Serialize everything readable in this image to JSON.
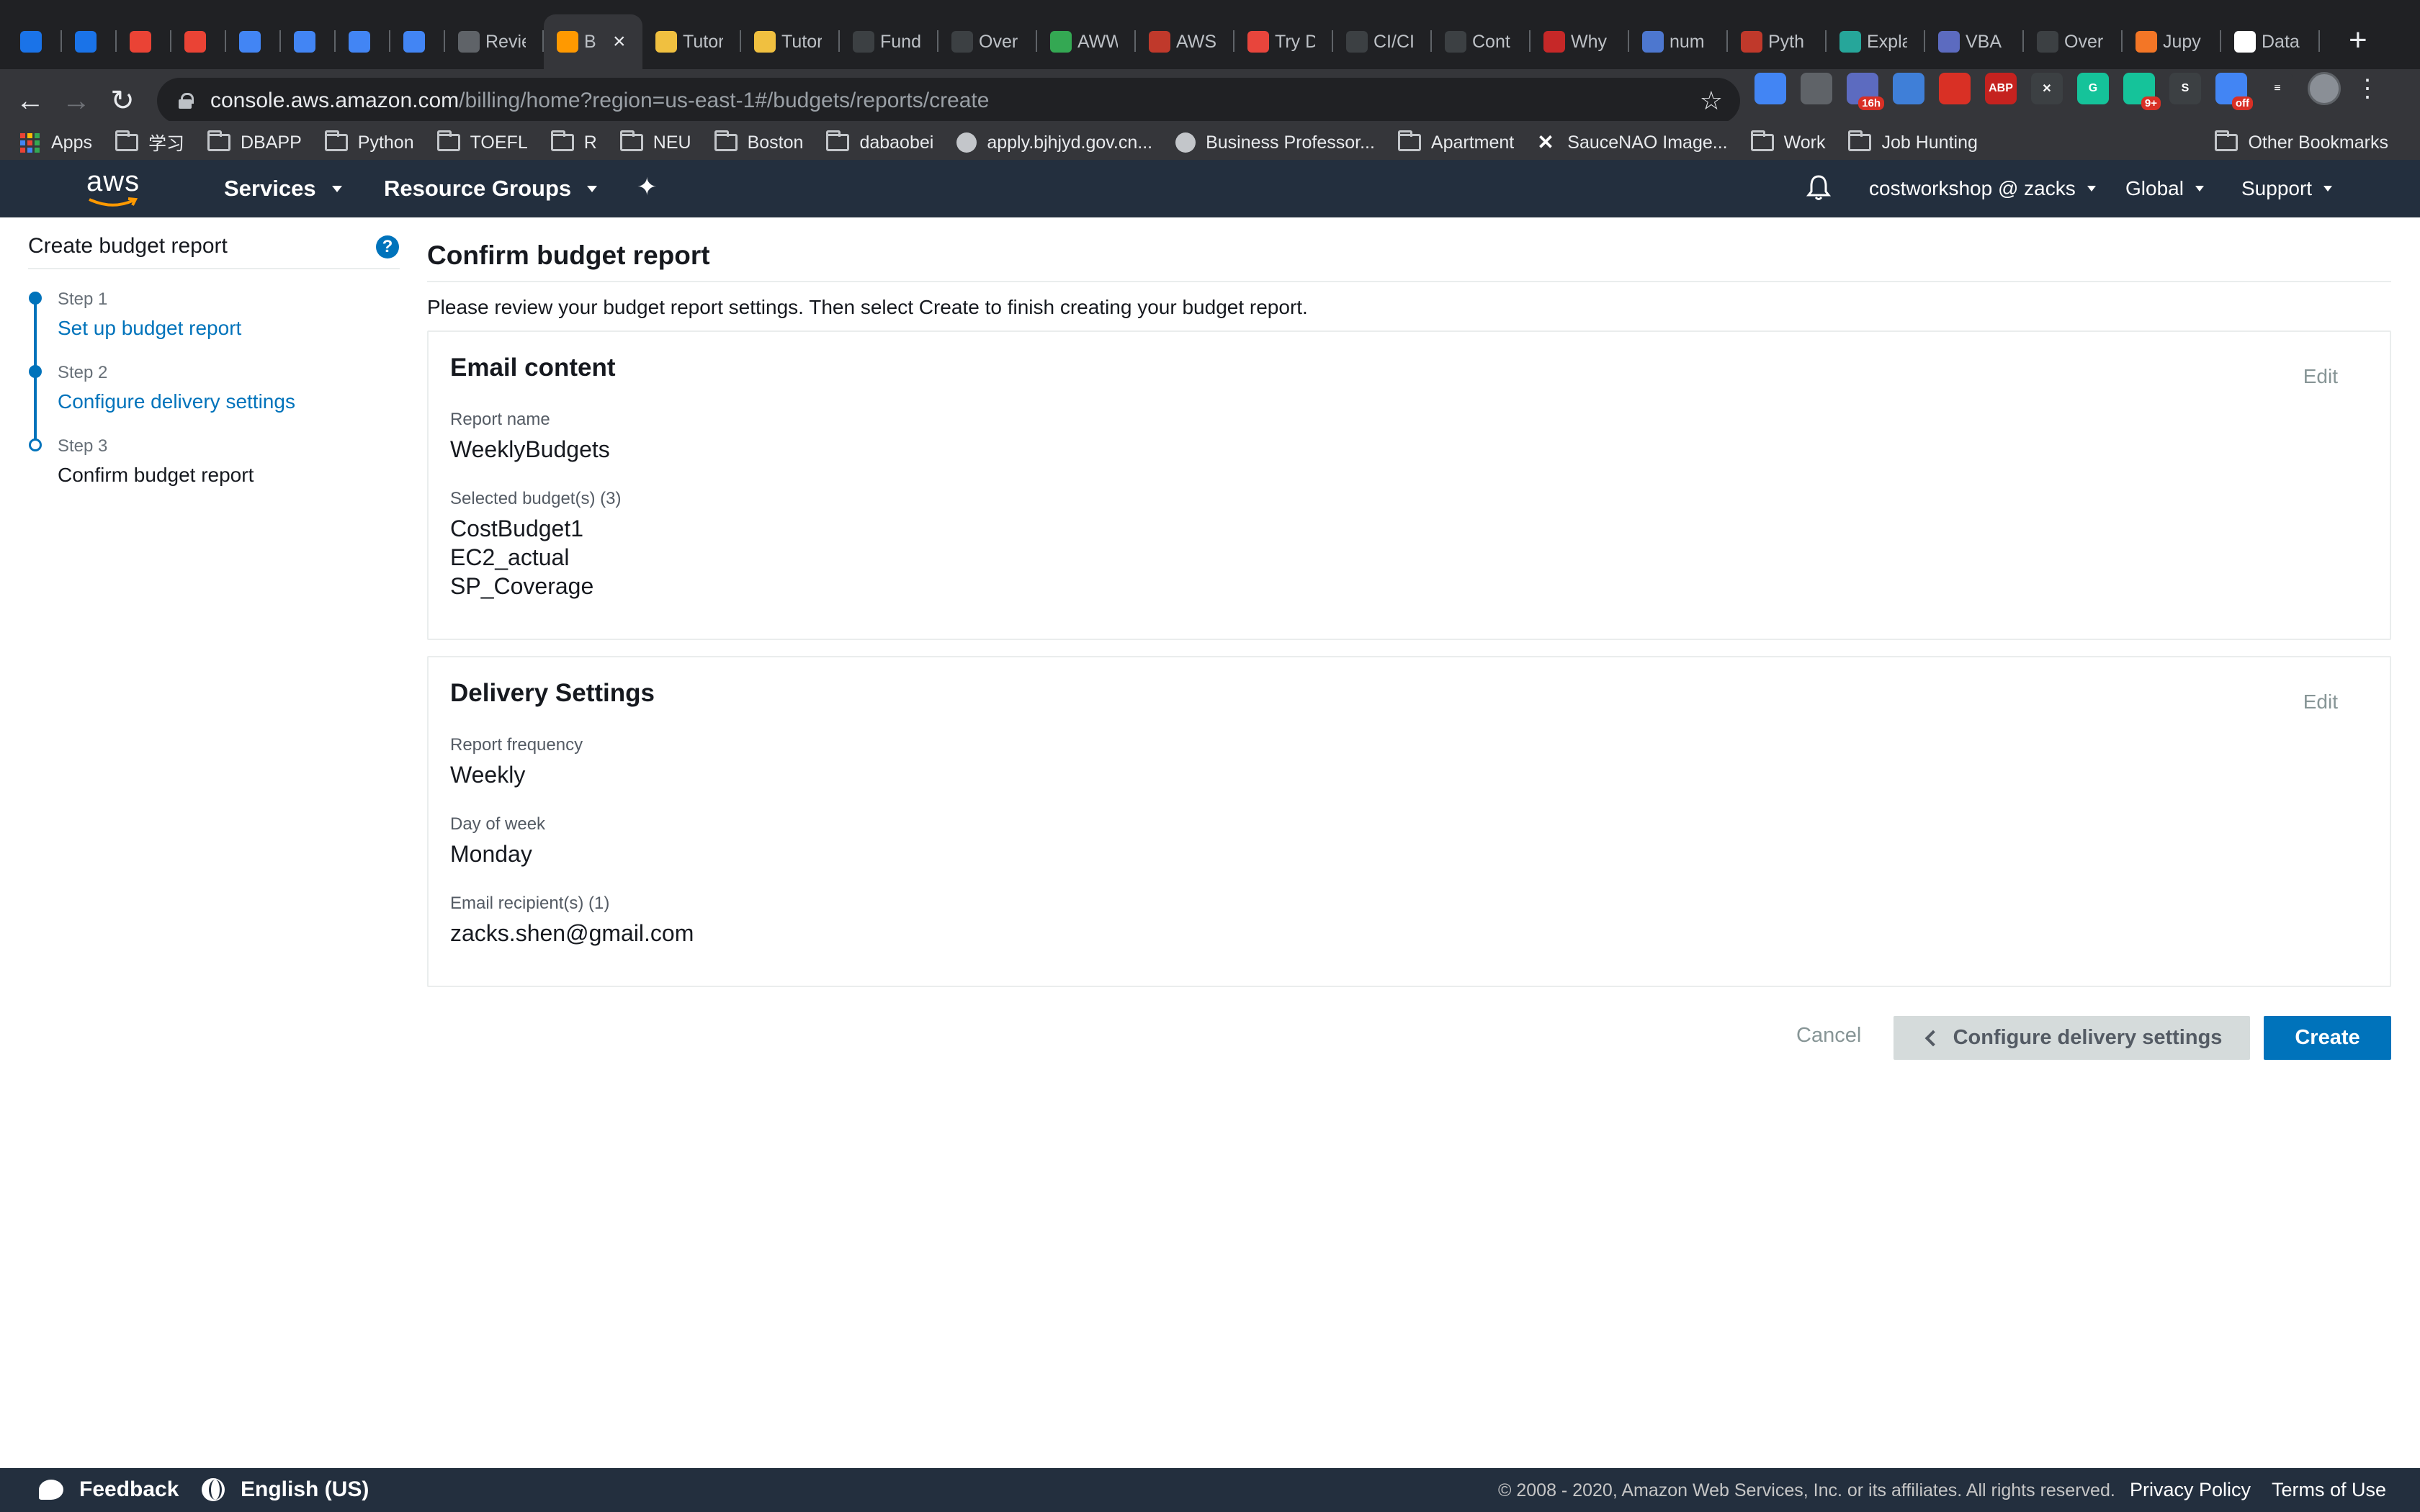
{
  "browser": {
    "tabs": [
      {
        "title": "",
        "icon": "google-calendar-icon",
        "color": "#1a73e8"
      },
      {
        "title": "",
        "icon": "google-calendar-icon",
        "color": "#1a73e8"
      },
      {
        "title": "",
        "icon": "gmail-icon",
        "color": "#ea4335"
      },
      {
        "title": "",
        "icon": "gmail-icon",
        "color": "#ea4335"
      },
      {
        "title": "",
        "icon": "google-translate-icon",
        "color": "#4285f4"
      },
      {
        "title": "",
        "icon": "google-translate-icon",
        "color": "#4285f4"
      },
      {
        "title": "",
        "icon": "google-translate-icon",
        "color": "#4285f4"
      },
      {
        "title": "",
        "icon": "google-translate-icon",
        "color": "#4285f4"
      },
      {
        "title": "Revie",
        "icon": "page-icon",
        "color": "#5f6368"
      },
      {
        "title": "B",
        "icon": "aws-box-icon",
        "color": "#ff9900",
        "active": true
      },
      {
        "title": "Tutor",
        "icon": "aws-box-icon",
        "color": "#f0c040"
      },
      {
        "title": "Tutor",
        "icon": "aws-box-icon",
        "color": "#f0c040"
      },
      {
        "title": "Fund",
        "icon": "mortarboard-icon",
        "color": "#3c4043"
      },
      {
        "title": "Over",
        "icon": "mortarboard-icon",
        "color": "#3c4043"
      },
      {
        "title": "AWW",
        "icon": "w-icon",
        "color": "#34a853"
      },
      {
        "title": "AWS",
        "icon": "aws-swirl-icon",
        "color": "#c0392b"
      },
      {
        "title": "Try D",
        "icon": "layers-icon",
        "color": "#e8453c"
      },
      {
        "title": "CI/CI",
        "icon": "circle-p-icon",
        "color": "#3c4043"
      },
      {
        "title": "Cont",
        "icon": "github-icon",
        "color": "#3c4043"
      },
      {
        "title": "Why",
        "icon": "flag-icon",
        "color": "#c62828"
      },
      {
        "title": "num",
        "icon": "numpy-icon",
        "color": "#4d77cf"
      },
      {
        "title": "Pyth",
        "icon": "aws-swirl-icon",
        "color": "#c0392b"
      },
      {
        "title": "Expla",
        "icon": "chart-icon",
        "color": "#26a69a"
      },
      {
        "title": "VBA",
        "icon": "chess-icon",
        "color": "#5c6bc0"
      },
      {
        "title": "Over",
        "icon": "mortarboard-icon",
        "color": "#3c4043"
      },
      {
        "title": "Jupy",
        "icon": "jupyter-icon",
        "color": "#f37626"
      },
      {
        "title": "Data",
        "icon": "wikipedia-icon",
        "color": "#ffffff"
      }
    ],
    "url_host": "console.aws.amazon.com",
    "url_path": "/billing/home?region=us-east-1#/budgets/reports/create",
    "extensions": [
      {
        "icon": "translate-ext-icon",
        "color": "#4285f4",
        "text": ""
      },
      {
        "icon": "bulb-ext-icon",
        "color": "#5f6368",
        "text": ""
      },
      {
        "icon": "calendar-ext-icon",
        "color": "#5c6bc0",
        "text": "",
        "badge": "16h"
      },
      {
        "icon": "iq-ext-icon",
        "color": "#3f7fd8",
        "text": ""
      },
      {
        "icon": "hand-ext-icon",
        "color": "#d93025",
        "text": ""
      },
      {
        "icon": "abp-ext-icon",
        "color": "#c5221f",
        "text": "ABP"
      },
      {
        "icon": "x-ext-icon",
        "color": "#3c4043",
        "text": "✕"
      },
      {
        "icon": "grammarly-ext-icon",
        "color": "#15c39a",
        "text": "G"
      },
      {
        "icon": "grammarly-ext-icon",
        "color": "#15c39a",
        "text": "",
        "badge": "9+"
      },
      {
        "icon": "sb-ext-icon",
        "color": "#3c4043",
        "text": "S"
      },
      {
        "icon": "calendar-ext-icon",
        "color": "#4285f4",
        "text": "",
        "badge": "off"
      },
      {
        "icon": "playlist-ext-icon",
        "color": "#35363a",
        "text": "≡"
      }
    ],
    "bookmarks": [
      {
        "label": "Apps",
        "icon": "apps-grid-icon"
      },
      {
        "label": "学习",
        "icon": "folder-icon"
      },
      {
        "label": "DBAPP",
        "icon": "folder-icon"
      },
      {
        "label": "Python",
        "icon": "folder-icon"
      },
      {
        "label": "TOEFL",
        "icon": "folder-icon"
      },
      {
        "label": "R",
        "icon": "folder-icon"
      },
      {
        "label": "NEU",
        "icon": "folder-icon"
      },
      {
        "label": "Boston",
        "icon": "folder-icon"
      },
      {
        "label": "dabaobei",
        "icon": "folder-icon"
      },
      {
        "label": "apply.bjhjyd.gov.cn...",
        "icon": "globe-icon"
      },
      {
        "label": "Business Professor...",
        "icon": "person-icon"
      },
      {
        "label": "Apartment",
        "icon": "folder-icon"
      },
      {
        "label": "SauceNAO Image...",
        "icon": "x-box-icon"
      },
      {
        "label": "Work",
        "icon": "folder-icon"
      },
      {
        "label": "Job Hunting",
        "icon": "folder-icon"
      }
    ],
    "other_bookmarks": "Other Bookmarks"
  },
  "aws_header": {
    "logo": "aws",
    "services": "Services",
    "resource_groups": "Resource Groups",
    "account": "costworkshop @ zacks",
    "region": "Global",
    "support": "Support"
  },
  "wizard": {
    "title": "Create budget report",
    "steps": [
      {
        "label": "Step 1",
        "name": "Set up budget report"
      },
      {
        "label": "Step 2",
        "name": "Configure delivery settings"
      },
      {
        "label": "Step 3",
        "name": "Confirm budget report"
      }
    ]
  },
  "main": {
    "title": "Confirm budget report",
    "intro": "Please review your budget report settings. Then select Create to finish creating your budget report.",
    "email_content": {
      "heading": "Email content",
      "edit": "Edit",
      "report_name_label": "Report name",
      "report_name": "WeeklyBudgets",
      "budgets_label": "Selected budget(s) (3)",
      "budgets": [
        "CostBudget1",
        "EC2_actual",
        "SP_Coverage"
      ]
    },
    "delivery": {
      "heading": "Delivery Settings",
      "edit": "Edit",
      "frequency_label": "Report frequency",
      "frequency": "Weekly",
      "day_label": "Day of week",
      "day": "Monday",
      "recipients_label": "Email recipient(s) (1)",
      "recipient": "zacks.shen@gmail.com"
    },
    "actions": {
      "cancel": "Cancel",
      "back": "Configure delivery settings",
      "create": "Create"
    }
  },
  "footer": {
    "feedback": "Feedback",
    "language": "English (US)",
    "copyright": "© 2008 - 2020, Amazon Web Services, Inc. or its affiliates. All rights reserved.",
    "privacy": "Privacy Policy",
    "terms": "Terms of Use"
  },
  "colors": {
    "aws_nav": "#232f3e",
    "link_blue": "#0073bb",
    "aws_orange": "#ff9900"
  }
}
